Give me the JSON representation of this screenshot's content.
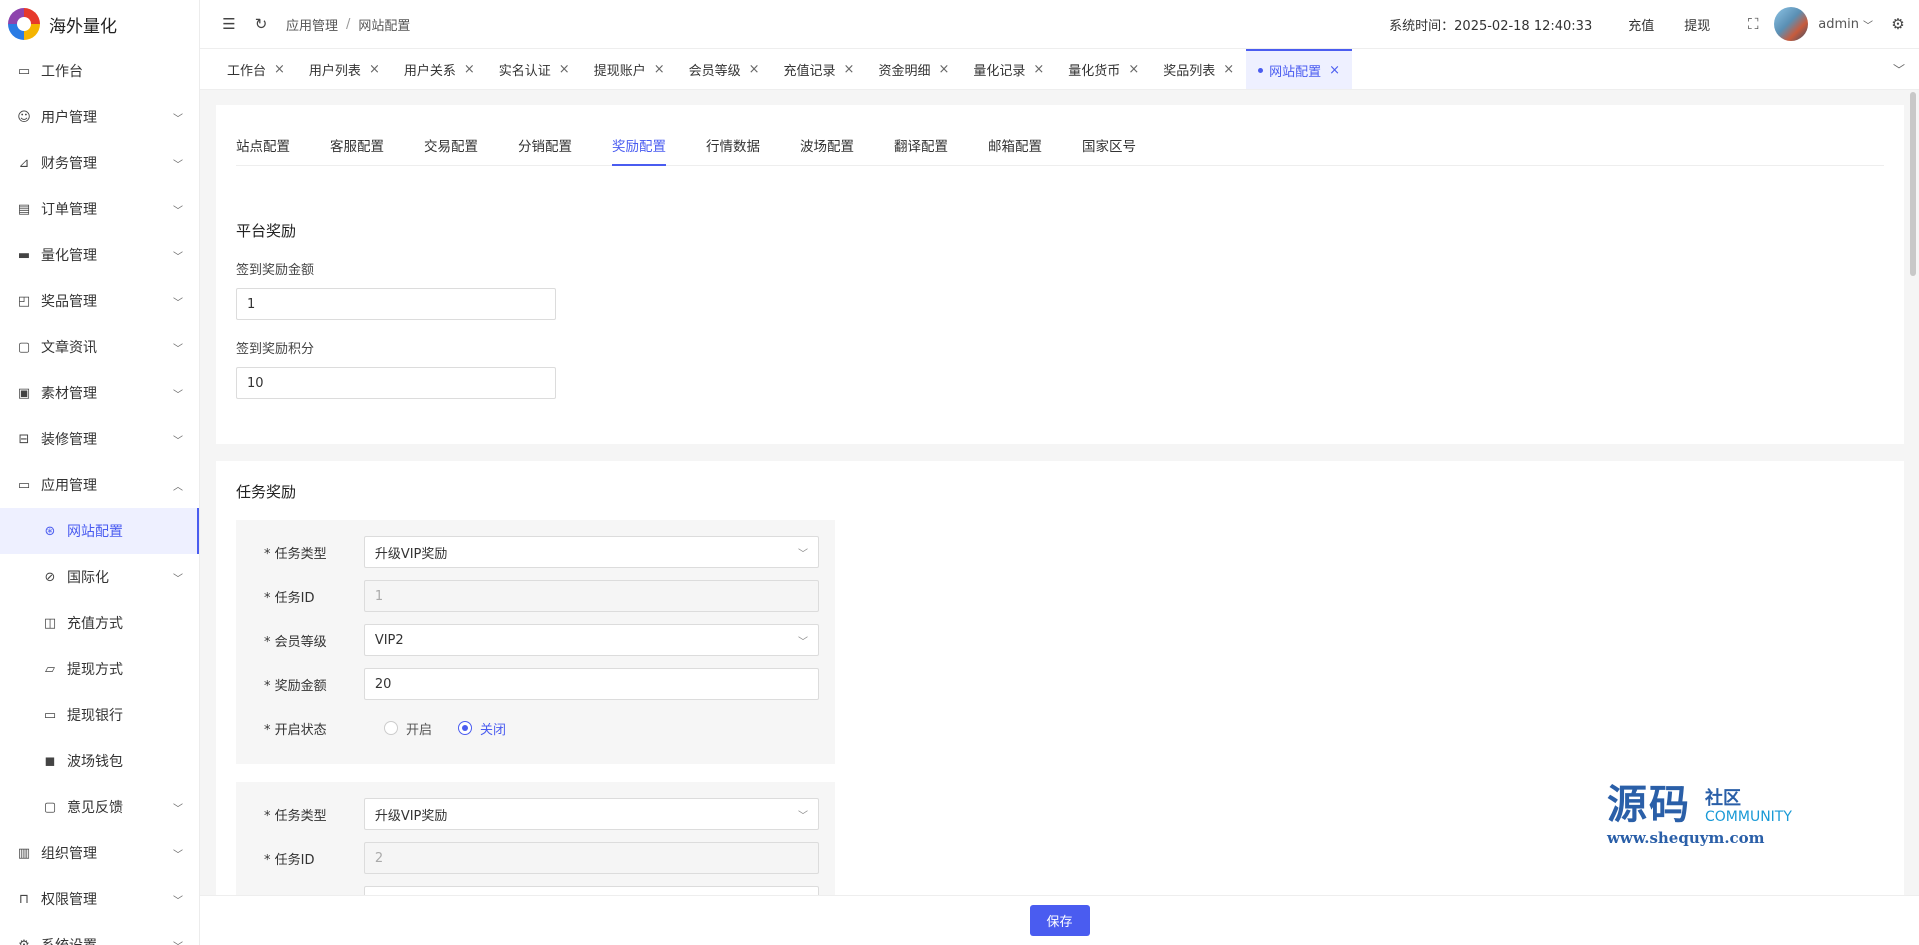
{
  "app": {
    "name": "海外量化"
  },
  "sidebar": {
    "items": [
      {
        "label": "工作台",
        "icon": "monitor-icon",
        "expandable": false
      },
      {
        "label": "用户管理",
        "icon": "user-icon",
        "expandable": true
      },
      {
        "label": "财务管理",
        "icon": "chart-icon",
        "expandable": true
      },
      {
        "label": "订单管理",
        "icon": "document-icon",
        "expandable": true
      },
      {
        "label": "量化管理",
        "icon": "tool-icon",
        "expandable": true
      },
      {
        "label": "奖品管理",
        "icon": "bag-icon",
        "expandable": true
      },
      {
        "label": "文章资讯",
        "icon": "comment-icon",
        "expandable": true
      },
      {
        "label": "素材管理",
        "icon": "image-icon",
        "expandable": true
      },
      {
        "label": "装修管理",
        "icon": "brush-icon",
        "expandable": true
      },
      {
        "label": "应用管理",
        "icon": "app-icon",
        "expandable": true,
        "expanded": true
      },
      {
        "label": "网站配置",
        "icon": "globe-icon",
        "sub": true,
        "active": true
      },
      {
        "label": "国际化",
        "icon": "language-icon",
        "sub": true,
        "expandable": true
      },
      {
        "label": "充值方式",
        "icon": "wallet-icon",
        "sub": true
      },
      {
        "label": "提现方式",
        "icon": "folder-icon",
        "sub": true
      },
      {
        "label": "提现银行",
        "icon": "card-icon",
        "sub": true
      },
      {
        "label": "波场钱包",
        "icon": "wallet-fill-icon",
        "sub": true
      },
      {
        "label": "意见反馈",
        "icon": "feedback-icon",
        "sub": true,
        "expandable": true
      },
      {
        "label": "组织管理",
        "icon": "building-icon",
        "expandable": true
      },
      {
        "label": "权限管理",
        "icon": "lock-icon",
        "expandable": true
      },
      {
        "label": "系统设置",
        "icon": "settings-icon",
        "expandable": true
      }
    ]
  },
  "header": {
    "breadcrumb": [
      "应用管理",
      "网站配置"
    ],
    "system_time": "系统时间：2025-02-18 12:40:33",
    "recharge": "充值",
    "withdraw": "提现",
    "user": "admin"
  },
  "tabs": [
    "工作台",
    "用户列表",
    "用户关系",
    "实名认证",
    "提现账户",
    "会员等级",
    "充值记录",
    "资金明细",
    "量化记录",
    "量化货币",
    "奖品列表",
    "网站配置"
  ],
  "active_tab": "网站配置",
  "subtabs": [
    "站点配置",
    "客服配置",
    "交易配置",
    "分销配置",
    "奖励配置",
    "行情数据",
    "波场配置",
    "翻译配置",
    "邮箱配置",
    "国家区号"
  ],
  "active_subtab": "奖励配置",
  "platform_reward": {
    "title": "平台奖励",
    "checkin_amount_label": "签到奖励金额",
    "checkin_amount": "1",
    "checkin_points_label": "签到奖励积分",
    "checkin_points": "10"
  },
  "task_reward": {
    "title": "任务奖励",
    "labels": {
      "type": "* 任务类型",
      "id": "* 任务ID",
      "level": "* 会员等级",
      "amount": "* 奖励金额",
      "status": "* 开启状态"
    },
    "radio_on": "开启",
    "radio_off": "关闭",
    "tasks": [
      {
        "type": "升级VIP奖励",
        "id": "1",
        "level": "VIP2",
        "amount": "20",
        "status": "关闭"
      },
      {
        "type": "升级VIP奖励",
        "id": "2"
      }
    ]
  },
  "footer": {
    "save": "保存"
  },
  "watermark": {
    "big": "源码",
    "cn": "社区",
    "en": "COMMUNITY",
    "url": "www.shequym.com"
  },
  "colors": {
    "accent": "#4a5cf0",
    "watermark": "#2a5fa8"
  }
}
